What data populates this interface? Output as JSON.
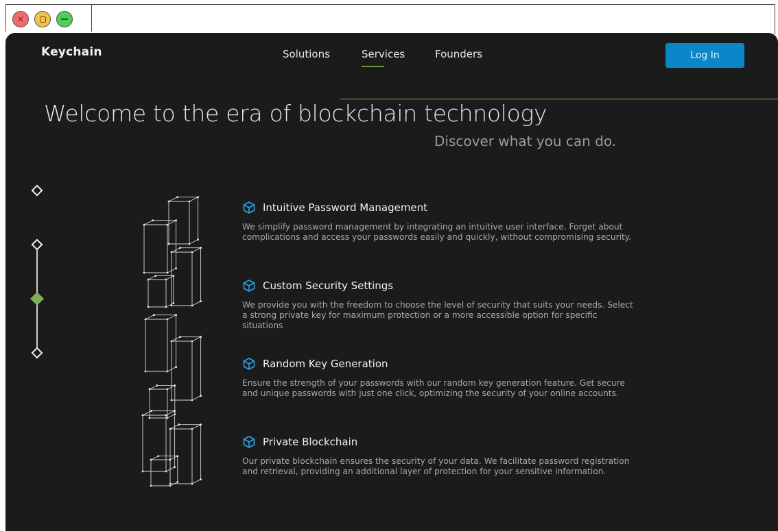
{
  "window": {
    "close_symbol": "×",
    "max_icon": "square-icon",
    "min_icon": "minus-icon"
  },
  "header": {
    "brand": "Keychain",
    "nav": [
      {
        "label": "Solutions"
      },
      {
        "label": "Services"
      },
      {
        "label": "Founders"
      }
    ],
    "active_nav": "Services",
    "login_label": "Log In"
  },
  "hero": {
    "title": "Welcome to the era of blockchain technology",
    "subtitle": "Discover what you can do."
  },
  "features": [
    {
      "icon": "cube-icon",
      "title": "Intuitive Password Management",
      "description": "We simplify password management by integrating an intuitive user interface. Forget about complications and access your passwords easily and quickly, without compromising security."
    },
    {
      "icon": "cube-icon",
      "title": "Custom Security Settings",
      "description": "We provide you with the freedom to choose the level of security that suits your needs. Select a strong private key for maximum protection or a more accessible option for specific situations"
    },
    {
      "icon": "cube-icon",
      "title": "Random Key Generation",
      "description": "Ensure the strength of your passwords with our random key generation feature. Get secure and unique passwords with just one click, optimizing the security of your online accounts."
    },
    {
      "icon": "cube-icon",
      "title": "Private Blockchain",
      "description": "Our private blockchain ensures the security of your data. We facilitate password registration and retrieval, providing an additional layer of protection for your sensitive information."
    }
  ],
  "slider": {
    "steps": 4,
    "active_index": 2
  },
  "colors": {
    "background": "#1b1b1b",
    "accent_blue": "#0b86c9",
    "accent_green": "#7fae5a",
    "icon_blue": "#2aa6e8"
  }
}
